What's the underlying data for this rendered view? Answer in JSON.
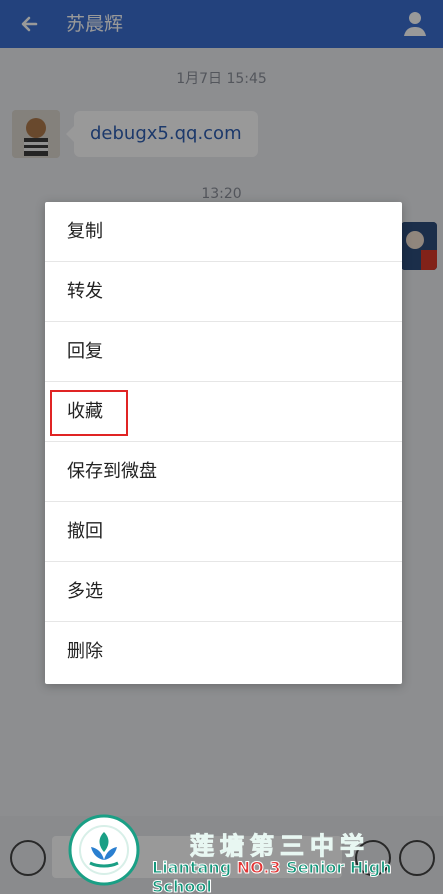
{
  "header": {
    "title": "苏晨辉"
  },
  "chat": {
    "time1": "1月7日  15:45",
    "message1": "debugx5.qq.com",
    "time2": "13:20"
  },
  "context_menu": {
    "items": [
      "复制",
      "转发",
      "回复",
      "收藏",
      "保存到微盘",
      "撤回",
      "多选",
      "删除"
    ],
    "highlighted_item": "收藏"
  },
  "watermark": {
    "school_cn": "莲塘第三中学",
    "school_en_prefix": "Liantang",
    "school_en_number": "NO.3",
    "school_en_suffix": "Senior High School"
  },
  "colors": {
    "header": "#3b6fd1",
    "highlight_box": "#e02424",
    "watermark_green": "#1a9f85"
  }
}
